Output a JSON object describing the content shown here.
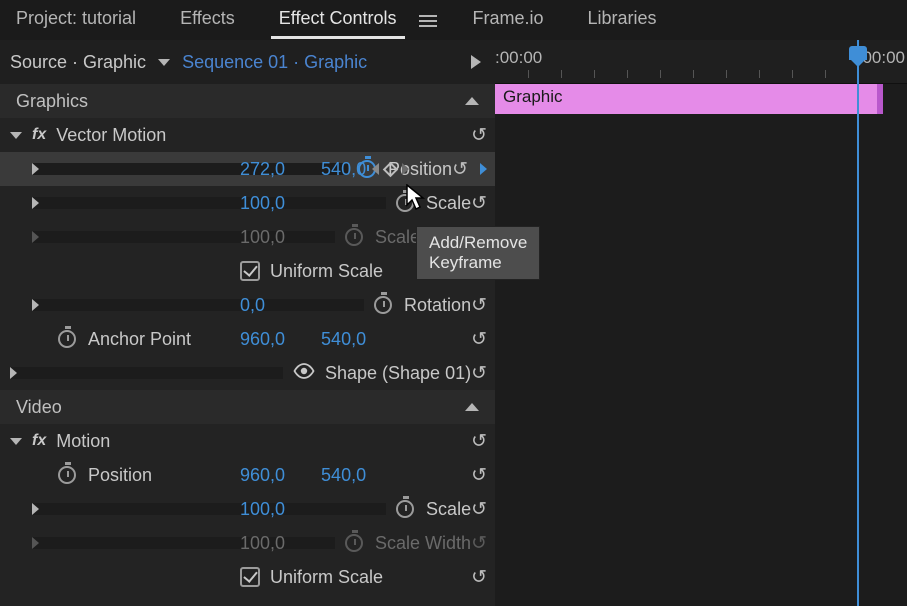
{
  "tabs": {
    "project": "Project: tutorial",
    "effects": "Effects",
    "effect_controls": "Effect Controls",
    "frameio": "Frame.io",
    "libraries": "Libraries"
  },
  "breadcrumb": {
    "source": "Source · Graphic",
    "sequence": "Sequence 01 · Graphic"
  },
  "sections": {
    "graphics": "Graphics",
    "video": "Video"
  },
  "effects": {
    "vector_motion": {
      "name": "Vector Motion",
      "position": {
        "label": "Position",
        "x": "272,0",
        "y": "540,0"
      },
      "scale": {
        "label": "Scale",
        "v": "100,0"
      },
      "scale_width": {
        "label": "Scale Width",
        "v": "100,0"
      },
      "uniform_scale": {
        "label": "Uniform Scale"
      },
      "rotation": {
        "label": "Rotation",
        "v": "0,0"
      },
      "anchor": {
        "label": "Anchor Point",
        "x": "960,0",
        "y": "540,0"
      }
    },
    "shape": {
      "name": "Shape (Shape 01)"
    },
    "motion": {
      "name": "Motion",
      "position": {
        "label": "Position",
        "x": "960,0",
        "y": "540,0"
      },
      "scale": {
        "label": "Scale",
        "v": "100,0"
      },
      "scale_width": {
        "label": "Scale Width",
        "v": "100,0"
      },
      "uniform_scale": {
        "label": "Uniform Scale"
      }
    }
  },
  "timeline": {
    "tc_start": ":00:00",
    "tc_end": "00:00",
    "clip": "Graphic"
  },
  "tooltip": "Add/Remove Keyframe"
}
